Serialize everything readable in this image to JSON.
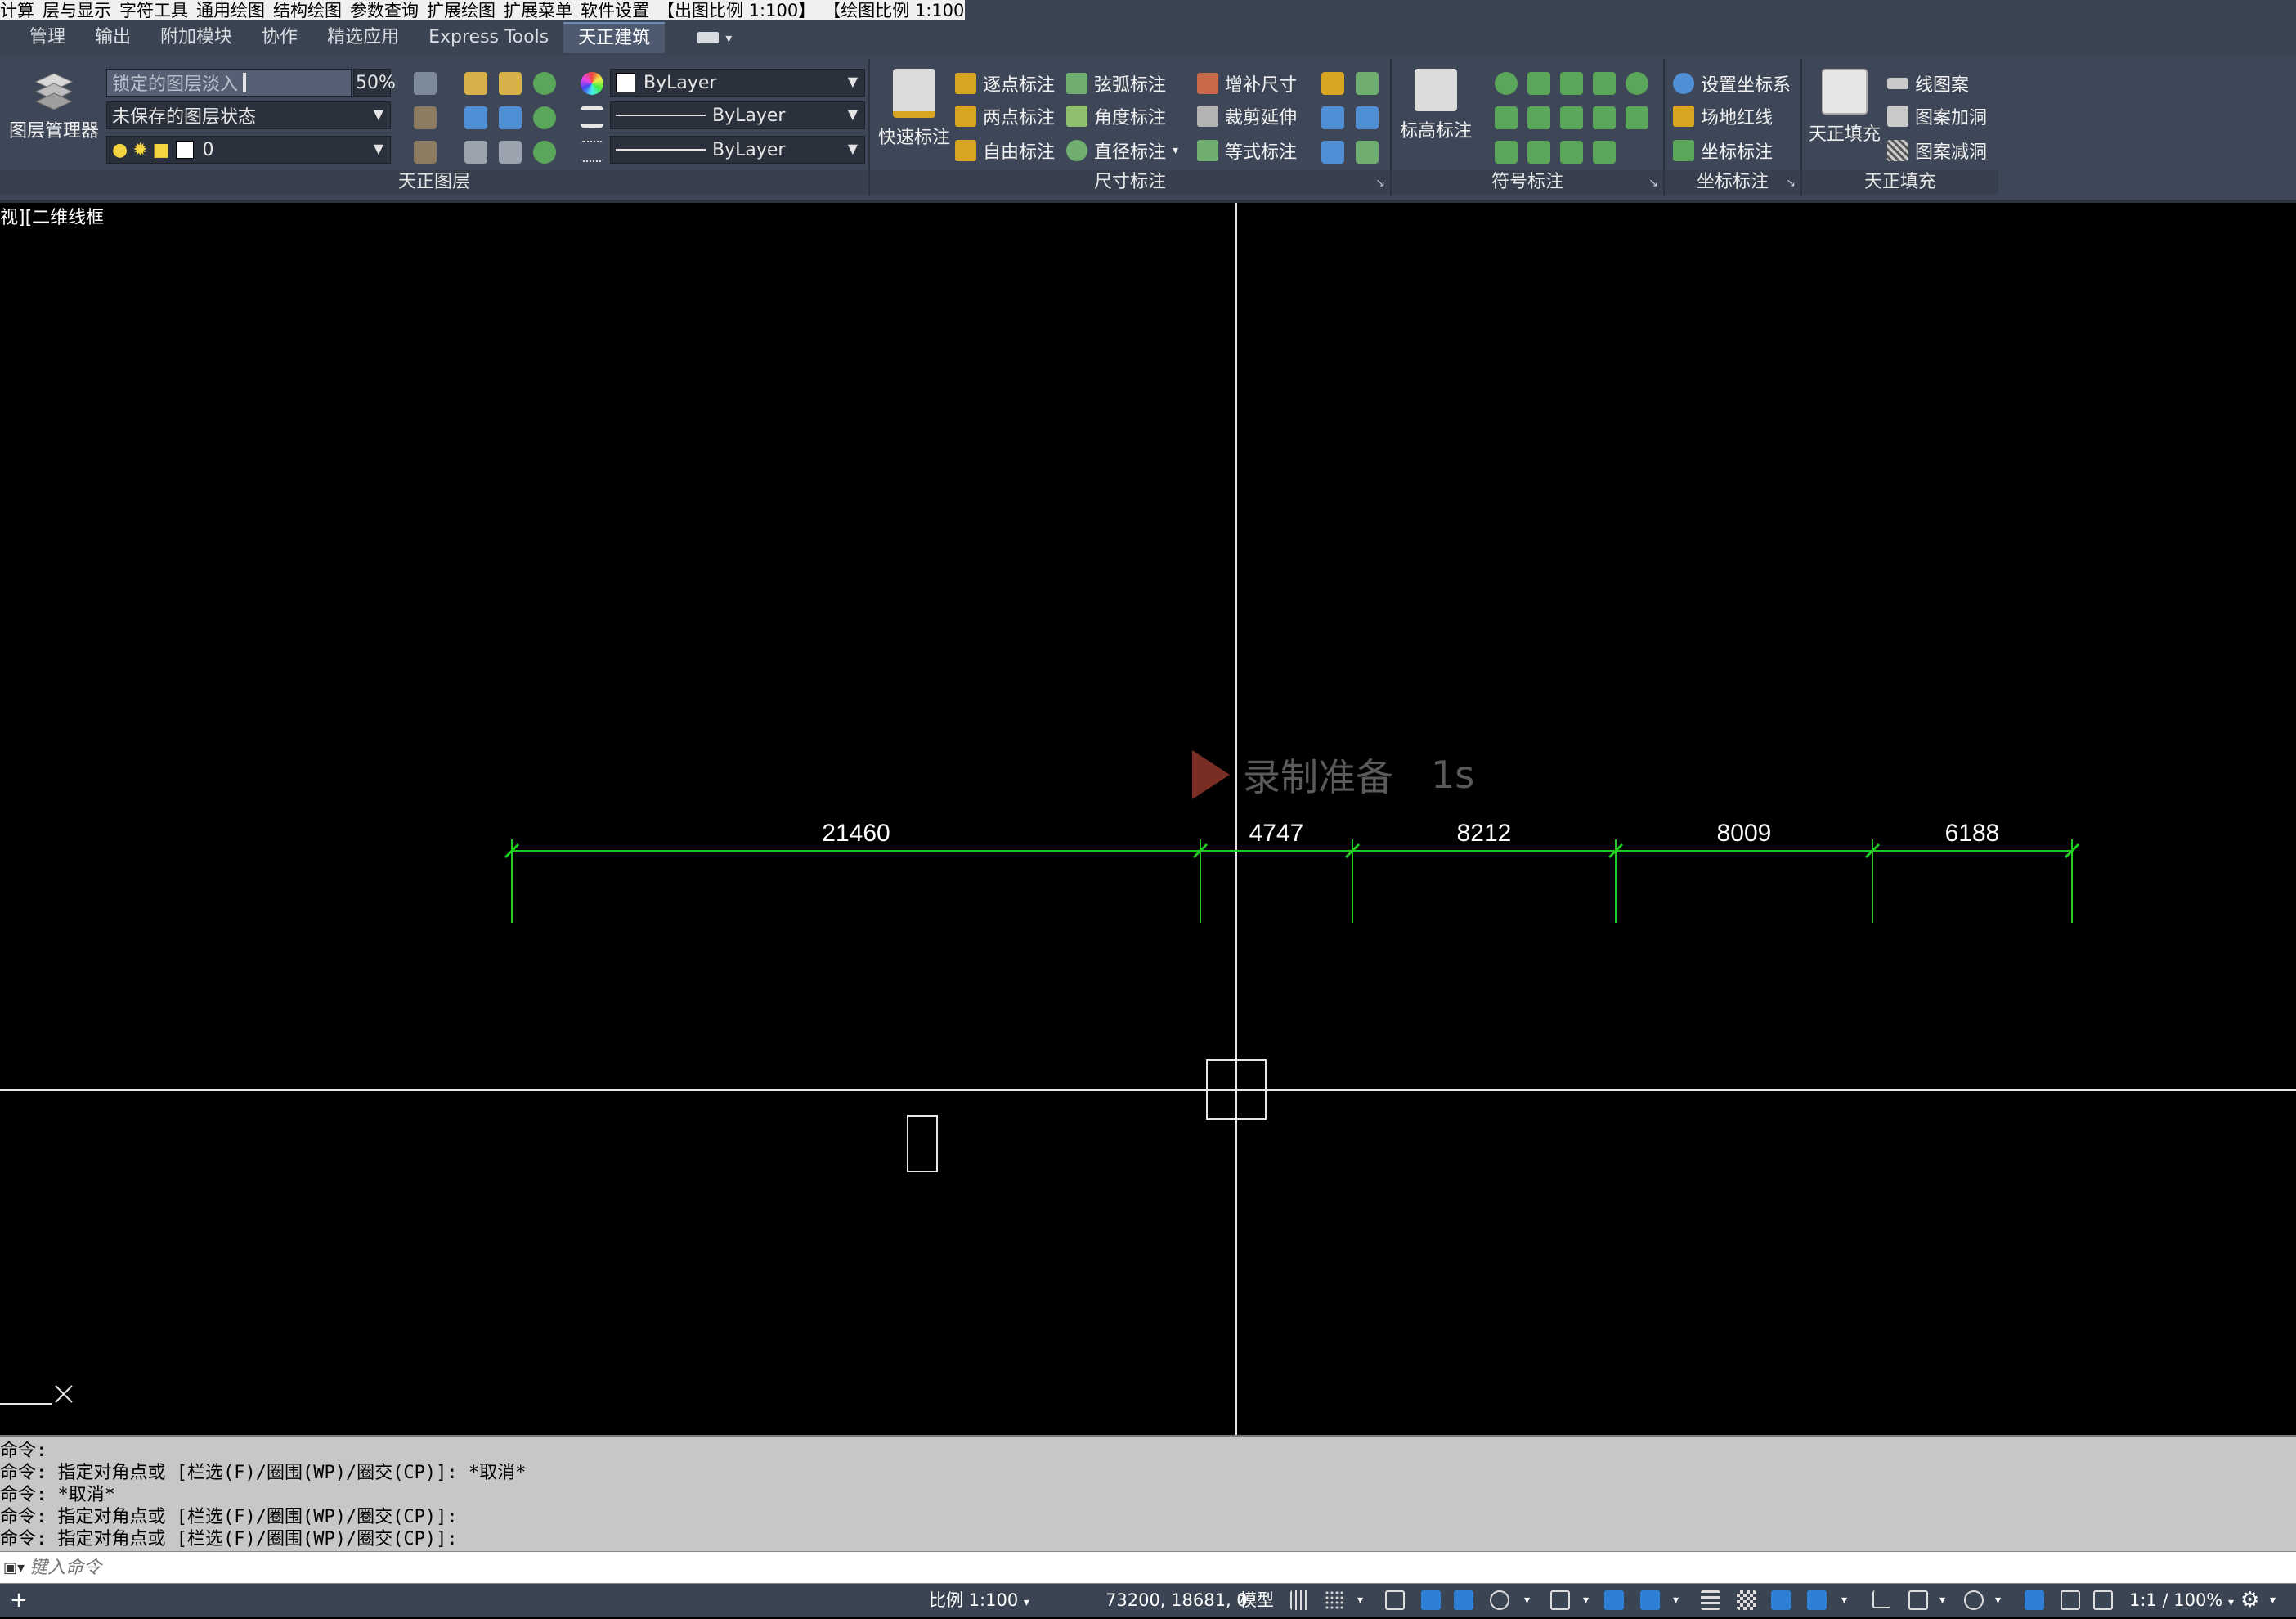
{
  "menubar": {
    "items": [
      "计算",
      "层与显示",
      "字符工具",
      "通用绘图",
      "结构绘图",
      "参数查询",
      "扩展绘图",
      "扩展菜单",
      "软件设置",
      "【出图比例 1:100】",
      "【绘图比例 1:100】"
    ]
  },
  "tabs": [
    {
      "label": "管理"
    },
    {
      "label": "输出"
    },
    {
      "label": "附加模块"
    },
    {
      "label": "协作"
    },
    {
      "label": "精选应用"
    },
    {
      "label": "Express Tools"
    },
    {
      "label": "天正建筑",
      "active": true
    }
  ],
  "ribbon": {
    "layers_panel": {
      "title": "天正图层",
      "manager_label": "图层管理器",
      "fade_label": "锁定的图层淡入",
      "fade_value": "50%",
      "layer_state": "未保存的图层状态",
      "current_layer": "0"
    },
    "properties": {
      "color": "ByLayer",
      "linetype": "ByLayer",
      "lineweight": "ByLayer"
    },
    "dimension_panel": {
      "title": "尺寸标注",
      "quick_label": "快速标注",
      "buttons": [
        "逐点标注",
        "两点标注",
        "自由标注",
        "弦弧标注",
        "角度标注",
        "直径标注",
        "增补尺寸",
        "裁剪延伸",
        "等式标注"
      ]
    },
    "elevation_label": "标高标注",
    "symbol_panel": {
      "title": "符号标注"
    },
    "coord_panel": {
      "title": "坐标标注",
      "buttons": [
        "设置坐标系",
        "场地红线",
        "坐标标注"
      ]
    },
    "fill_panel": {
      "title": "天正填充",
      "fill_label": "天正填充",
      "buttons": [
        "线图案",
        "图案加洞",
        "图案减洞"
      ]
    }
  },
  "viewport": {
    "label": "视][二维线框",
    "watermark_text": "录制准备",
    "watermark_time": "1s"
  },
  "dimensions": {
    "values": [
      "21460",
      "4747",
      "8212",
      "8009",
      "6188"
    ]
  },
  "command": {
    "history": [
      "命令:",
      "命令: 指定对角点或 [栏选(F)/圈围(WP)/圈交(CP)]: *取消*",
      "命令: *取消*",
      "命令: 指定对角点或 [栏选(F)/圈围(WP)/圈交(CP)]:",
      "命令: 指定对角点或 [栏选(F)/圈围(WP)/圈交(CP)]:"
    ],
    "placeholder": "键入命令"
  },
  "status": {
    "scale": "比例 1:100",
    "coords": "73200, 18681, 0",
    "model": "模型",
    "anno_scale": "1:1 / 100%"
  },
  "colors": {
    "dim_green": "#1fcc1f",
    "ribbon_bg": "#3e4757",
    "tab_bg": "#3b4453"
  }
}
